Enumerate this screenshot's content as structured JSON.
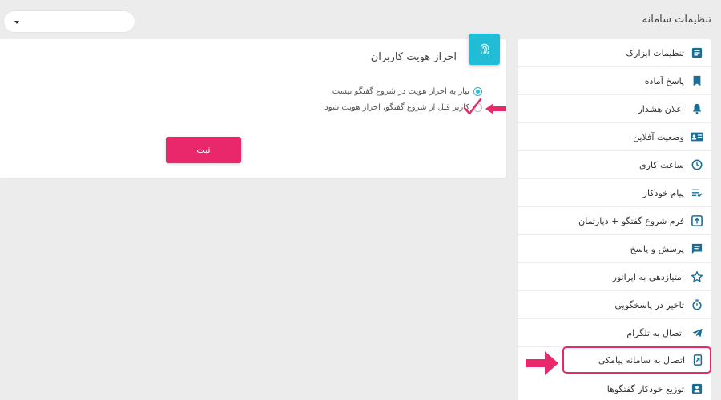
{
  "header": {
    "title": "تنظیمات سامانه"
  },
  "dropdown": {
    "value": ""
  },
  "card": {
    "title": "احراز هویت کاربران",
    "options": [
      {
        "label": "نیاز به احراز هویت در شروع گفتگو نیست",
        "checked": true
      },
      {
        "label": "کاربر قبل از شروع گفتگو، احراز هویت شود",
        "checked": false
      }
    ],
    "submit_label": "ثبت"
  },
  "sidebar": {
    "items": [
      {
        "label": "تنظیمات ابزارک",
        "icon": "widget-settings-icon"
      },
      {
        "label": "پاسخ آماده",
        "icon": "bookmark-icon"
      },
      {
        "label": "اعلان هشدار",
        "icon": "bell-icon"
      },
      {
        "label": "وضعیت آفلاین",
        "icon": "id-card-icon"
      },
      {
        "label": "ساعت کاری",
        "icon": "clock-icon"
      },
      {
        "label": "پیام خودکار",
        "icon": "auto-message-icon"
      },
      {
        "label": "فرم شروع گفتگو + دپارتمان",
        "icon": "form-icon"
      },
      {
        "label": "پرسش و پاسخ",
        "icon": "faq-icon"
      },
      {
        "label": "امتیازدهی به اپراتور",
        "icon": "star-icon"
      },
      {
        "label": "تاخیر در پاسخگویی",
        "icon": "timer-icon"
      },
      {
        "label": "اتصال به تلگرام",
        "icon": "telegram-icon"
      },
      {
        "label": "اتصال به سامانه پیامکی",
        "icon": "sms-icon"
      },
      {
        "label": "توزیع خودکار گفتگوها",
        "icon": "distribution-icon"
      }
    ]
  },
  "colors": {
    "accent": "#21bcd6",
    "primary": "#e8286b",
    "icon": "#1a6d94"
  }
}
